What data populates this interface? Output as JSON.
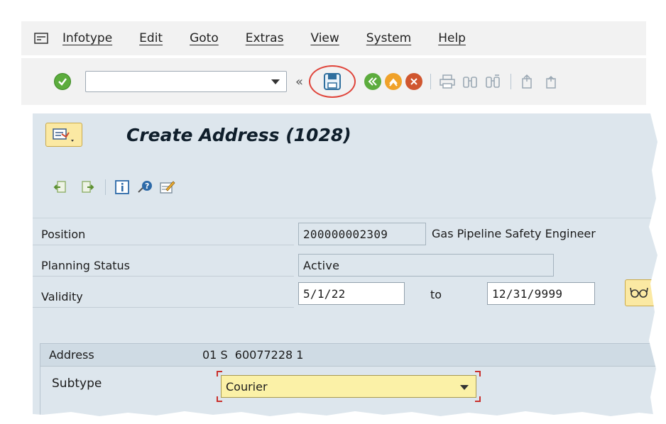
{
  "menu": {
    "items": [
      "Infotype",
      "Edit",
      "Goto",
      "Extras",
      "View",
      "System",
      "Help"
    ]
  },
  "toolbar": {
    "command_field_value": "",
    "collapse_glyph": "«",
    "icons": [
      "ok-icon",
      "save-icon",
      "back-icon",
      "exit-icon",
      "cancel-icon",
      "print-icon",
      "find-icon",
      "find-next-icon",
      "first-page-icon",
      "previous-page-icon"
    ]
  },
  "screen": {
    "title": "Create Address (1028)"
  },
  "app_toolbar": {
    "icons": [
      "previous-record-icon",
      "next-record-icon",
      "info-icon",
      "help-icon",
      "change-icon"
    ]
  },
  "form": {
    "position_label": "Position",
    "position_id": "200000002309",
    "position_name": "Gas Pipeline Safety Engineer",
    "planning_status_label": "Planning Status",
    "planning_status_value": "Active",
    "validity_label": "Validity",
    "validity_from": "5/1/22",
    "to_label": "to",
    "validity_to": "12/31/9999"
  },
  "address_group": {
    "label": "Address",
    "value": "01 S  60077228 1",
    "subtype_label": "Subtype",
    "subtype_value": "Courier"
  },
  "colors": {
    "accent_highlight": "#e0443a",
    "panel_bg": "#dde6ed",
    "input_required_bg": "#fbf1a7"
  }
}
